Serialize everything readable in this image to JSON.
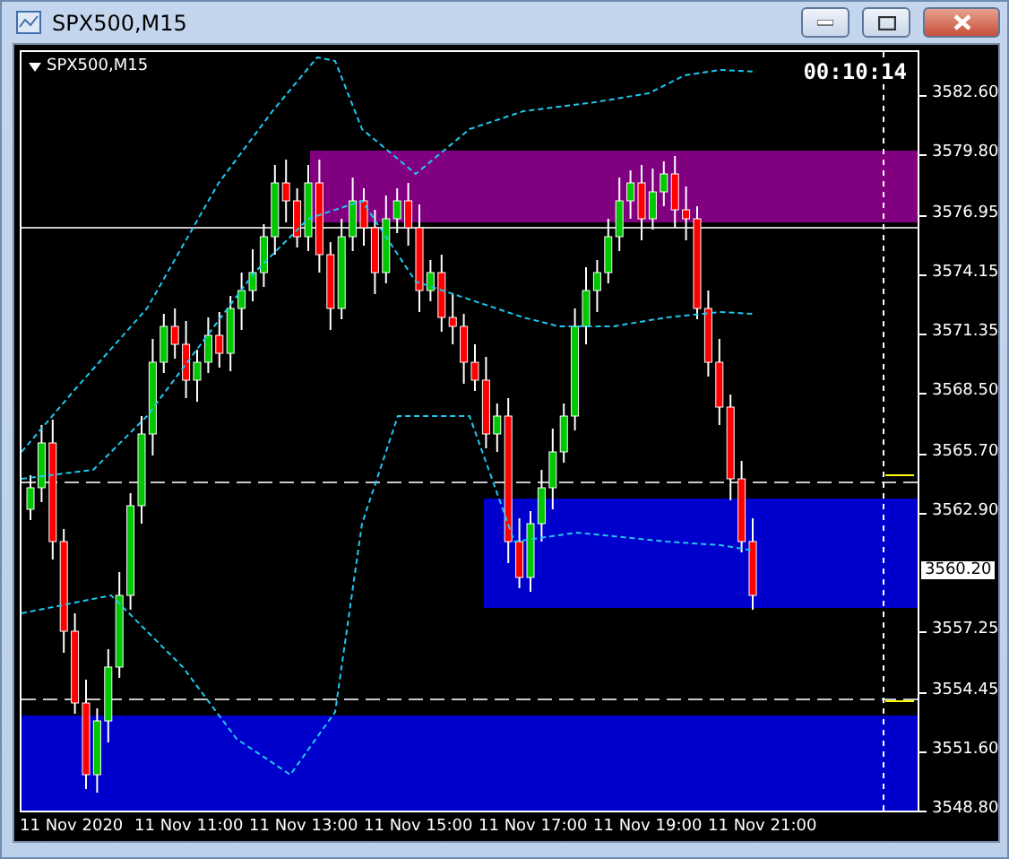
{
  "window": {
    "title": "SPX500,M15"
  },
  "chart": {
    "symbol_label": "SPX500,M15",
    "timer": "00:10:14",
    "current_price": "3560.20",
    "price_axis": [
      "3582.60",
      "3579.80",
      "3576.95",
      "3574.15",
      "3571.35",
      "3568.50",
      "3565.70",
      "3562.90",
      "3557.25",
      "3554.45",
      "3551.60",
      "3548.80"
    ],
    "time_axis": [
      "11 Nov 2020",
      "11 Nov 11:00",
      "11 Nov 13:00",
      "11 Nov 15:00",
      "11 Nov 17:00",
      "11 Nov 19:00",
      "11 Nov 21:00"
    ]
  }
}
